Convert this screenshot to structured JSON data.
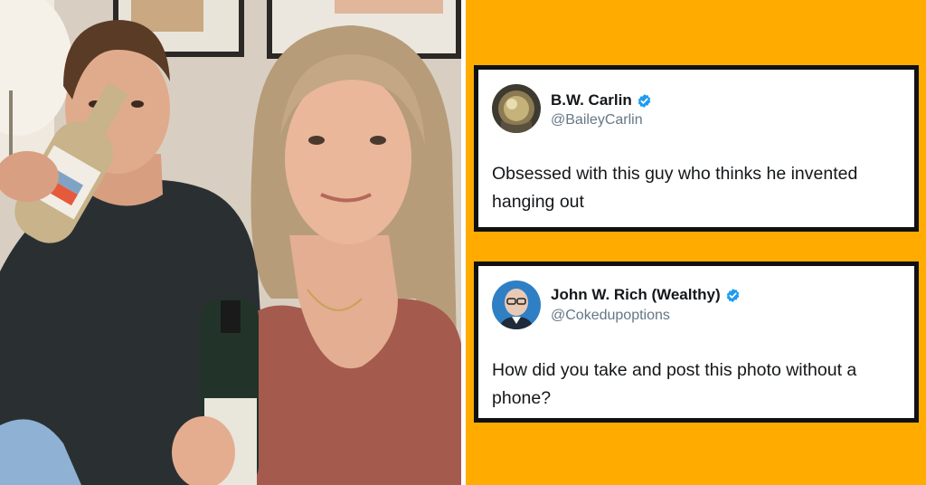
{
  "photo": {
    "description_icon": "selfie-photo"
  },
  "tweets": [
    {
      "display_name": "B.W. Carlin",
      "handle": "@BaileyCarlin",
      "verified": true,
      "text": "Obsessed with this guy who thinks he invented hanging out"
    },
    {
      "display_name": "John W. Rich (Wealthy)",
      "handle": "@Cokedupoptions",
      "verified": true,
      "text": "How did you take and post this photo without a phone?"
    }
  ],
  "colors": {
    "background": "#ffab00",
    "card_border": "#111111",
    "verified": "#1d9bf0",
    "handle": "#657786"
  }
}
